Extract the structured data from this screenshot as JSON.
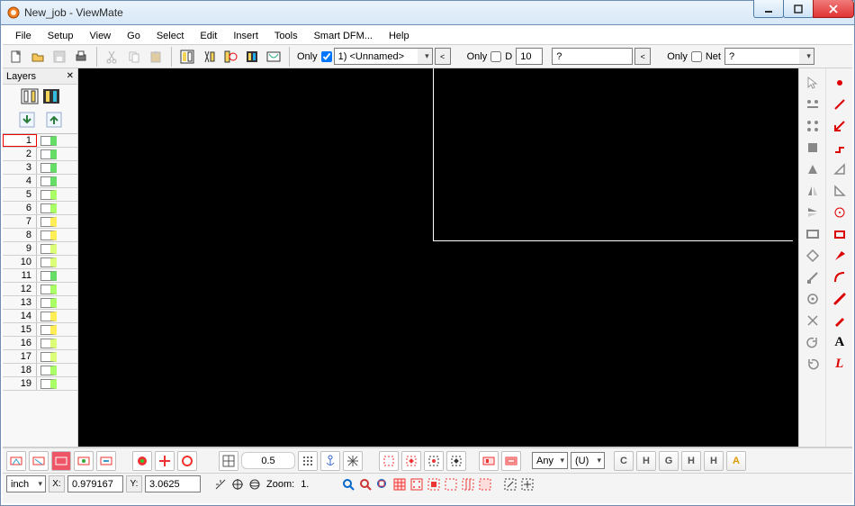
{
  "window": {
    "title": "New_job - ViewMate"
  },
  "menu": [
    "File",
    "Setup",
    "View",
    "Go",
    "Select",
    "Edit",
    "Insert",
    "Tools",
    "Smart DFM...",
    "Help"
  ],
  "toolbar": {
    "only1": "Only",
    "layer_dropdown": "1) <Unnamed>",
    "only2": "Only",
    "d_label": "D",
    "d_value": "10",
    "q1": "?",
    "only3": "Only",
    "net_label": "Net",
    "q2": "?"
  },
  "layers": {
    "title": "Layers",
    "rows": [
      {
        "n": 1,
        "color": "#66dd66",
        "selected": true
      },
      {
        "n": 2,
        "color": "#66dd66"
      },
      {
        "n": 3,
        "color": "#66dd66"
      },
      {
        "n": 4,
        "color": "#66dd66"
      },
      {
        "n": 5,
        "color": "#aaff66"
      },
      {
        "n": 6,
        "color": "#aaff66"
      },
      {
        "n": 7,
        "color": "#ffee55"
      },
      {
        "n": 8,
        "color": "#ffee55"
      },
      {
        "n": 9,
        "color": "#ddff77"
      },
      {
        "n": 10,
        "color": "#ddff77"
      },
      {
        "n": 11,
        "color": "#66dd66"
      },
      {
        "n": 12,
        "color": "#aaff66"
      },
      {
        "n": 13,
        "color": "#aaff66"
      },
      {
        "n": 14,
        "color": "#ffee55"
      },
      {
        "n": 15,
        "color": "#ffee55"
      },
      {
        "n": 16,
        "color": "#ddff77"
      },
      {
        "n": 17,
        "color": "#ddff77"
      },
      {
        "n": 18,
        "color": "#aaff66"
      },
      {
        "n": 19,
        "color": "#aaff66"
      }
    ]
  },
  "bottom1": {
    "num": "0.5",
    "any": "Any",
    "u": "(U)"
  },
  "status": {
    "unit": "inch",
    "x_lbl": "X:",
    "x_val": "0.979167",
    "y_lbl": "Y:",
    "y_val": "3.0625",
    "zoom_lbl": "Zoom:",
    "zoom_val": "1."
  },
  "letters": [
    "C",
    "H",
    "G",
    "H",
    "H",
    "A"
  ]
}
